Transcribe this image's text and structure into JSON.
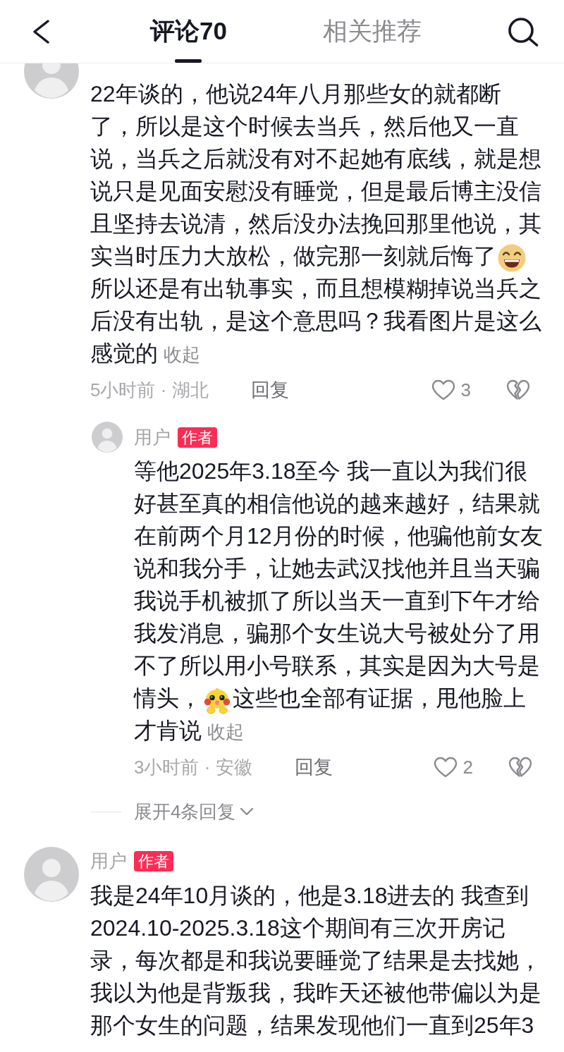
{
  "header": {
    "tabs": [
      {
        "label": "评论70",
        "selected": true
      },
      {
        "label": "相关推荐",
        "selected": false
      }
    ]
  },
  "comments": [
    {
      "partly_hidden": true,
      "body": [
        {
          "kind": "text",
          "text": "22年谈的，他说24年八月那些女的就都断了，所以是这个时候去当兵，然后他又一直说，当兵之后就没有对不起她有底线，就是想说只是见面安慰没有睡觉，但是最后博主没信且坚持去说清，然后没办法挽回那里他说，其实当时压力大放松，做完那一刻就后悔了"
        },
        {
          "kind": "grin"
        },
        {
          "kind": "text",
          "text": "所以还是有出轨事实，而且想模糊掉说当兵之后没有出轨，是这个意思吗？我看图片是这么感觉的"
        }
      ],
      "collapse_label": "收起",
      "meta": "5小时前 · 湖北",
      "reply_label": "回复",
      "likes": "3",
      "liked": false,
      "replies": [
        {
          "username": "用户",
          "badge": "作者",
          "body": [
            {
              "kind": "text",
              "text": "等他2025年3.18至今 我一直以为我们很好甚至真的相信他说的越来越好，结果就在前两个月12月份的时候，他骗他前女友说和我分手，让她去武汉找他并且当天骗我说手机被抓了所以当天一直到下午才给我发消息，骗那个女生说大号被处分了用不了所以用小号联系，其实是因为大号是情头，"
            },
            {
              "kind": "blush"
            },
            {
              "kind": "text",
              "text": "这些也全部有证据，甩他脸上才肯说"
            }
          ],
          "collapse_label": "收起",
          "meta": "3小时前 · 安徽",
          "reply_label": "回复",
          "likes": "2",
          "liked": false
        }
      ],
      "expand_label": "展开4条回复"
    },
    {
      "partly_hidden": false,
      "username": "用户",
      "badge": "作者",
      "body": [
        {
          "kind": "text",
          "text": "我是24年10月谈的，他是3.18进去的 我查到2024.10-2025.3.18这个期间有三次开房记录，每次都是和我说要睡觉了结果是去找她，我以为他是背叛我，我昨天还被他带偏以为是那个女生的问题，结果发现他们一直到25年3"
        }
      ]
    }
  ]
}
